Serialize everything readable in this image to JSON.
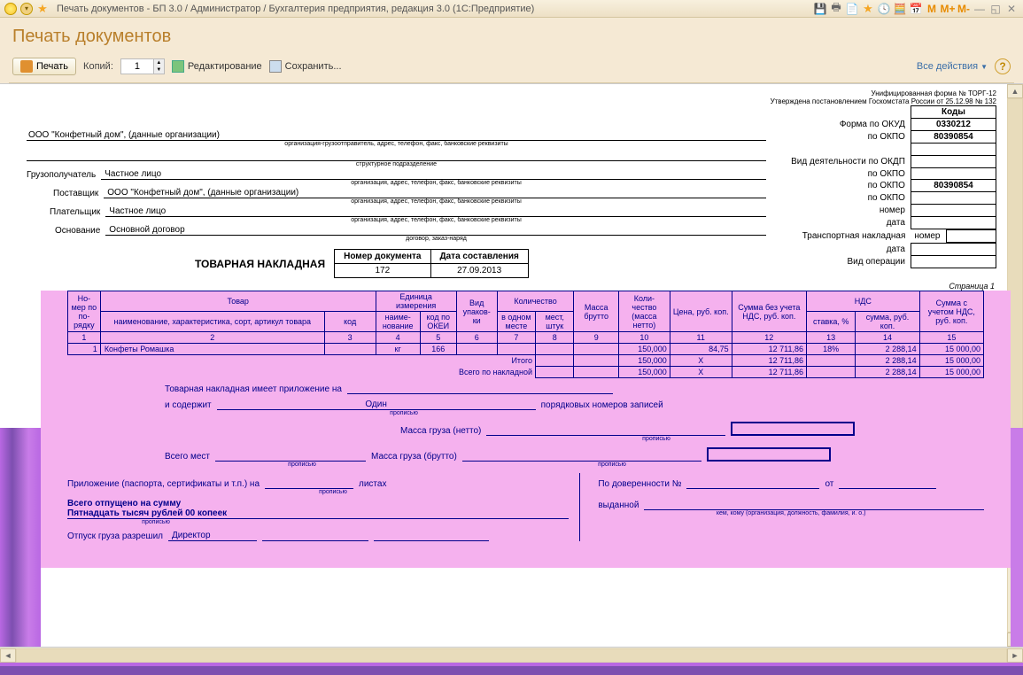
{
  "window": {
    "title": "Печать документов - БП 3.0 / Администратор / Бухгалтерия предприятия, редакция 3.0  (1С:Предприятие)",
    "m_labels": [
      "M",
      "M+",
      "M-"
    ]
  },
  "header": {
    "page_title": "Печать документов"
  },
  "toolbar": {
    "print_label": "Печать",
    "copies_label": "Копий:",
    "copies_value": "1",
    "edit_label": "Редактирование",
    "save_label": "Сохранить...",
    "all_actions": "Все действия"
  },
  "form": {
    "uni_form": "Унифицированная форма № ТОРГ-12",
    "approved": "Утверждена постановлением Госкомстата России от 25.12.98 № 132",
    "codes_header": "Коды",
    "form_okud_label": "Форма по ОКУД",
    "form_okud": "0330212",
    "okpo_label": "по ОКПО",
    "okpo1": "80390854",
    "okdp_label": "Вид деятельности по ОКДП",
    "okpo2": "",
    "okpo3": "80390854",
    "okpo4": "",
    "nomer_label": "номер",
    "data_label": "дата",
    "trans_label": "Транспортная накладная",
    "oper_label": "Вид операции",
    "org": "ООО \"Конфетный дом\",  (данные организации)",
    "org_hint": "организация-грузоотправитель, адрес, телефон, факс, банковские реквизиты",
    "sub_hint": "структурное подразделение",
    "consignee_lbl": "Грузополучатель",
    "consignee": "Частное лицо",
    "party_hint": "организация, адрес, телефон, факс, банковские реквизиты",
    "supplier_lbl": "Поставщик",
    "supplier": "ООО \"Конфетный дом\",  (данные организации)",
    "payer_lbl": "Плательщик",
    "payer": "Частное лицо",
    "basis_lbl": "Основание",
    "basis": "Основной договор",
    "basis_hint": "договор, заказ-наряд",
    "doc_title": "ТОВАРНАЯ НАКЛАДНАЯ",
    "num_header": "Номер документа",
    "date_header": "Дата составления",
    "doc_num": "172",
    "doc_date": "27.09.2013",
    "page_num": "Страница 1"
  },
  "table": {
    "headers": {
      "row_num": "Но-\nмер\nпо по-\nрядку",
      "goods": "Товар",
      "unit": "Единица измерения",
      "pack": "Вид\nупаков-\nки",
      "qty_group": "Количество",
      "gross": "Масса\nбрутто",
      "qty_net": "Коли-\nчество\n(масса\nнетто)",
      "price": "Цена,\nруб. коп.",
      "sum_novat": "Сумма без\nучета НДС,\nруб. коп.",
      "vat": "НДС",
      "sum_vat": "Сумма с\nучетом\nНДС,\nруб. коп.",
      "name": "наименование, характеристика, сорт,\nартикул товара",
      "code": "код",
      "unit_name": "наиме-нование",
      "okei": "код по\nОКЕИ",
      "in_one": "в\nодном\nместе",
      "places": "мест,\nштук",
      "rate": "ставка, %",
      "vat_sum": "сумма,\nруб. коп."
    },
    "col_nums": [
      "1",
      "2",
      "3",
      "4",
      "5",
      "6",
      "7",
      "8",
      "9",
      "10",
      "11",
      "12",
      "13",
      "14",
      "15"
    ],
    "rows": [
      {
        "n": "1",
        "name": "Конфеты Ромашка",
        "code": "",
        "unit": "кг",
        "okei": "166",
        "pack": "",
        "in_one": "",
        "places": "",
        "gross": "",
        "qty": "150,000",
        "price": "84,75",
        "sum": "12 711,86",
        "rate": "18%",
        "vat": "2 288,14",
        "total": "15 000,00"
      }
    ],
    "itogo_label": "Итого",
    "vsego_label": "Всего по накладной",
    "itogo": {
      "qty": "150,000",
      "price": "X",
      "sum": "12 711,86",
      "rate": "",
      "vat": "2 288,14",
      "total": "15 000,00"
    },
    "vsego": {
      "qty": "150,000",
      "price": "X",
      "sum": "12 711,86",
      "rate": "",
      "vat": "2 288,14",
      "total": "15 000,00"
    }
  },
  "footer": {
    "attach_lbl": "Товарная накладная имеет приложение на",
    "contains_lbl": "и содержит",
    "contains_val": "Один",
    "ord_lbl": "порядковых номеров записей",
    "propis": "прописью",
    "mass_net": "Масса груза (нетто)",
    "mass_gross": "Масса груза (брутто)",
    "places_lbl": "Всего мест",
    "app_lbl": "Приложение (паспорта, сертификаты и т.п.) на",
    "sheets": "листах",
    "total_lbl": "Всего отпущено  на сумму",
    "total_words": "Пятнадцать тысяч рублей 00 копеек",
    "release_lbl": "Отпуск груза разрешил",
    "release_pos": "Директор",
    "proxy_lbl": "По доверенности №",
    "from": "от",
    "issued": "выданной",
    "issued_hint": "кем, кому (организация, должность, фамилия, и. о.)"
  }
}
